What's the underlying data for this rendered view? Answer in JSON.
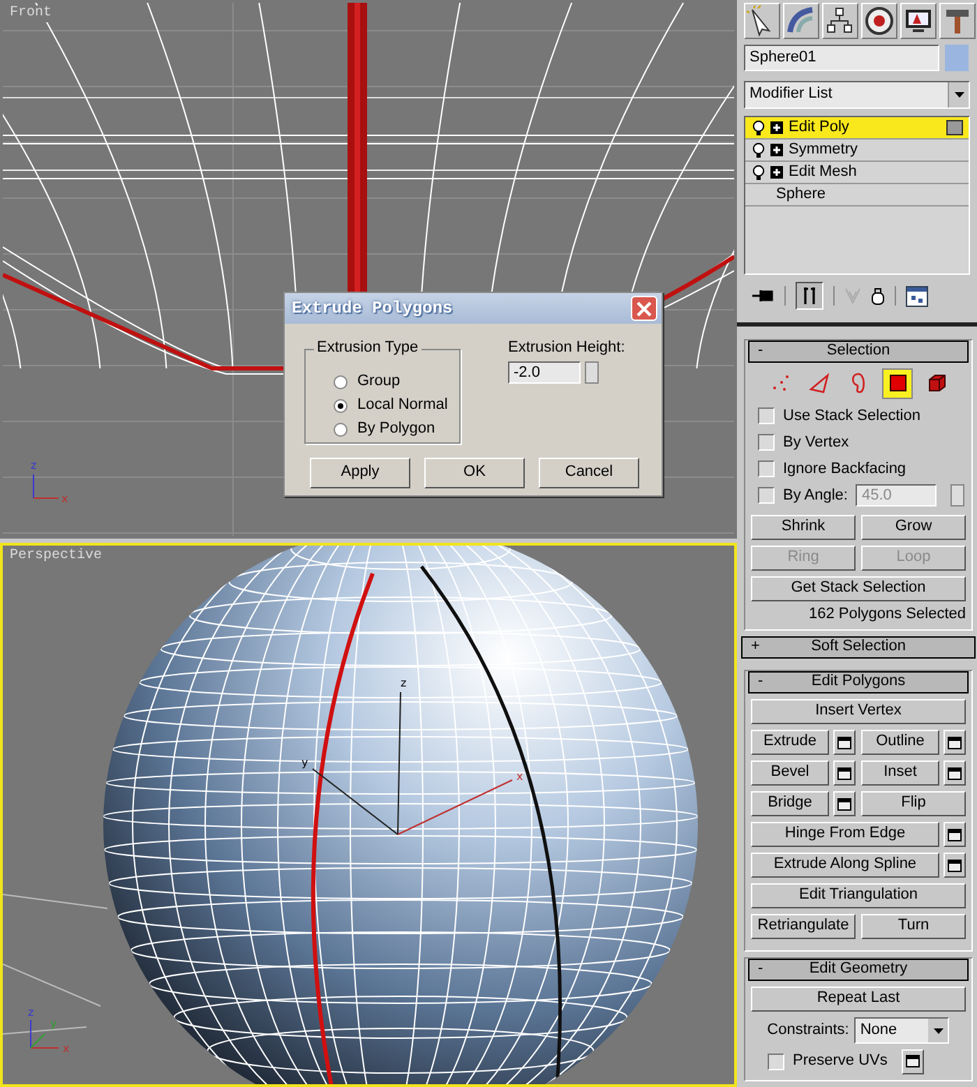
{
  "viewports": [
    {
      "label": "Front",
      "active": false,
      "axes": [
        "z",
        "x"
      ]
    },
    {
      "label": "Perspective",
      "active": true,
      "gizmo_axes": [
        "z",
        "y",
        "x"
      ],
      "axes": [
        "z",
        "y",
        "x"
      ]
    }
  ],
  "dialog": {
    "title": "Extrude Polygons",
    "group_label": "Extrusion Type",
    "options": [
      {
        "label": "Group",
        "selected": false
      },
      {
        "label": "Local Normal",
        "selected": true
      },
      {
        "label": "By Polygon",
        "selected": false
      }
    ],
    "height_label": "Extrusion Height:",
    "height_value": "-2.0",
    "buttons": [
      "Apply",
      "OK",
      "Cancel"
    ]
  },
  "object_name": "Sphere01",
  "modifier_list": "Modifier List",
  "stack": [
    {
      "label": "Edit Poly",
      "selected": true,
      "kind": "modifier"
    },
    {
      "label": "Symmetry",
      "selected": false,
      "kind": "modifier"
    },
    {
      "label": "Edit Mesh",
      "selected": false,
      "kind": "modifier"
    },
    {
      "label": "Sphere",
      "selected": false,
      "kind": "base"
    }
  ],
  "rollouts": [
    {
      "sign": "-",
      "title": "Selection",
      "expanded": true,
      "kind": "selection",
      "levels": [
        {
          "selected": false
        },
        {
          "selected": false
        },
        {
          "selected": false
        },
        {
          "selected": true
        },
        {
          "selected": false
        }
      ],
      "checks": [
        {
          "label": "Use Stack Selection",
          "checked": false
        },
        {
          "label": "By Vertex",
          "checked": false
        },
        {
          "label": "Ignore Backfacing",
          "checked": false
        },
        {
          "label": "By Angle:",
          "checked": false,
          "value": "45.0"
        }
      ],
      "buttons": [
        [
          {
            "label": "Shrink",
            "disabled": false
          },
          {
            "label": "Grow",
            "disabled": false
          }
        ],
        [
          {
            "label": "Ring",
            "disabled": true
          },
          {
            "label": "Loop",
            "disabled": true
          }
        ],
        [
          {
            "label": "Get Stack Selection",
            "disabled": false
          }
        ]
      ],
      "status": "162 Polygons Selected"
    },
    {
      "sign": "+",
      "title": "Soft Selection",
      "expanded": false
    },
    {
      "sign": "-",
      "title": "Edit Polygons",
      "expanded": true,
      "kind": "buttons",
      "rows": [
        [
          {
            "label": "Insert Vertex",
            "settings": false
          }
        ],
        [
          {
            "label": "Extrude",
            "settings": true
          },
          {
            "label": "Outline",
            "settings": true
          }
        ],
        [
          {
            "label": "Bevel",
            "settings": true
          },
          {
            "label": "Inset",
            "settings": true
          }
        ],
        [
          {
            "label": "Bridge",
            "settings": true
          },
          {
            "label": "Flip",
            "settings": false
          }
        ],
        [
          {
            "label": "Hinge From Edge",
            "settings": true
          }
        ],
        [
          {
            "label": "Extrude Along Spline",
            "settings": true
          }
        ],
        [
          {
            "label": "Edit Triangulation",
            "settings": false
          }
        ],
        [
          {
            "label": "Retriangulate",
            "settings": false
          },
          {
            "label": "Turn",
            "settings": false
          }
        ]
      ]
    },
    {
      "sign": "-",
      "title": "Edit Geometry",
      "expanded": true,
      "kind": "geometry",
      "repeat": "Repeat Last",
      "constraints_label": "Constraints:",
      "constraints_value": "None",
      "preserve": {
        "label": "Preserve UVs",
        "checked": false
      }
    }
  ]
}
